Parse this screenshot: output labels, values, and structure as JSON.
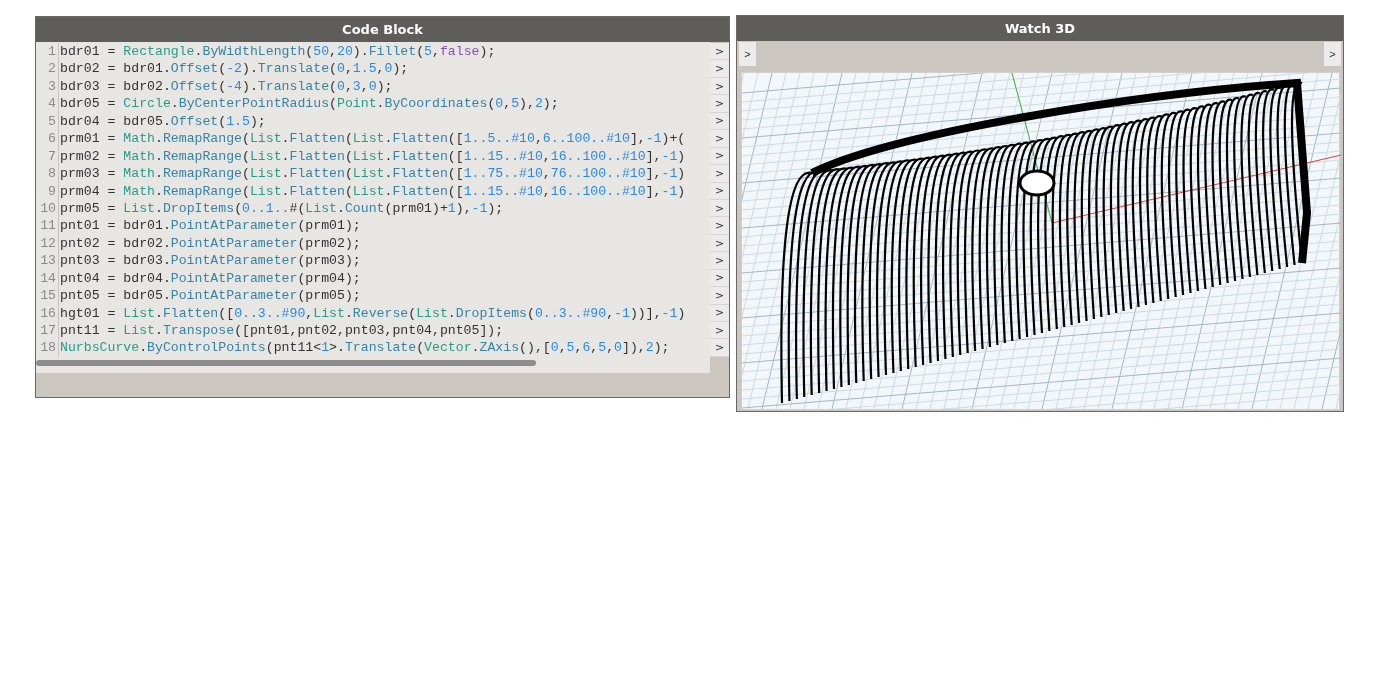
{
  "code_block": {
    "title": "Code Block",
    "lines": [
      {
        "number": "1",
        "port": ">",
        "tokens": [
          {
            "text": "bdr01 = ",
            "kind": "plain"
          },
          {
            "text": "Rectangle",
            "kind": "class"
          },
          {
            "text": ".",
            "kind": "plain"
          },
          {
            "text": "ByWidthLength",
            "kind": "method"
          },
          {
            "text": "(",
            "kind": "plain"
          },
          {
            "text": "50",
            "kind": "number"
          },
          {
            "text": ",",
            "kind": "plain"
          },
          {
            "text": "20",
            "kind": "number"
          },
          {
            "text": ").",
            "kind": "plain"
          },
          {
            "text": "Fillet",
            "kind": "method"
          },
          {
            "text": "(",
            "kind": "plain"
          },
          {
            "text": "5",
            "kind": "number"
          },
          {
            "text": ",",
            "kind": "plain"
          },
          {
            "text": "false",
            "kind": "keyword"
          },
          {
            "text": ");",
            "kind": "plain"
          }
        ]
      },
      {
        "number": "2",
        "port": ">",
        "tokens": [
          {
            "text": "bdr02 = bdr01.",
            "kind": "plain"
          },
          {
            "text": "Offset",
            "kind": "method"
          },
          {
            "text": "(",
            "kind": "plain"
          },
          {
            "text": "-2",
            "kind": "number"
          },
          {
            "text": ").",
            "kind": "plain"
          },
          {
            "text": "Translate",
            "kind": "method"
          },
          {
            "text": "(",
            "kind": "plain"
          },
          {
            "text": "0",
            "kind": "number"
          },
          {
            "text": ",",
            "kind": "plain"
          },
          {
            "text": "1.5",
            "kind": "number"
          },
          {
            "text": ",",
            "kind": "plain"
          },
          {
            "text": "0",
            "kind": "number"
          },
          {
            "text": ");",
            "kind": "plain"
          }
        ]
      },
      {
        "number": "3",
        "port": ">",
        "tokens": [
          {
            "text": "bdr03 = bdr02.",
            "kind": "plain"
          },
          {
            "text": "Offset",
            "kind": "method"
          },
          {
            "text": "(",
            "kind": "plain"
          },
          {
            "text": "-4",
            "kind": "number"
          },
          {
            "text": ").",
            "kind": "plain"
          },
          {
            "text": "Translate",
            "kind": "method"
          },
          {
            "text": "(",
            "kind": "plain"
          },
          {
            "text": "0",
            "kind": "number"
          },
          {
            "text": ",",
            "kind": "plain"
          },
          {
            "text": "3",
            "kind": "number"
          },
          {
            "text": ",",
            "kind": "plain"
          },
          {
            "text": "0",
            "kind": "number"
          },
          {
            "text": ");",
            "kind": "plain"
          }
        ]
      },
      {
        "number": "4",
        "port": ">",
        "tokens": [
          {
            "text": "bdr05 = ",
            "kind": "plain"
          },
          {
            "text": "Circle",
            "kind": "class"
          },
          {
            "text": ".",
            "kind": "plain"
          },
          {
            "text": "ByCenterPointRadius",
            "kind": "method"
          },
          {
            "text": "(",
            "kind": "plain"
          },
          {
            "text": "Point",
            "kind": "class"
          },
          {
            "text": ".",
            "kind": "plain"
          },
          {
            "text": "ByCoordinates",
            "kind": "method"
          },
          {
            "text": "(",
            "kind": "plain"
          },
          {
            "text": "0",
            "kind": "number"
          },
          {
            "text": ",",
            "kind": "plain"
          },
          {
            "text": "5",
            "kind": "number"
          },
          {
            "text": "),",
            "kind": "plain"
          },
          {
            "text": "2",
            "kind": "number"
          },
          {
            "text": ");",
            "kind": "plain"
          }
        ]
      },
      {
        "number": "5",
        "port": ">",
        "tokens": [
          {
            "text": "bdr04 = bdr05.",
            "kind": "plain"
          },
          {
            "text": "Offset",
            "kind": "method"
          },
          {
            "text": "(",
            "kind": "plain"
          },
          {
            "text": "1.5",
            "kind": "number"
          },
          {
            "text": ");",
            "kind": "plain"
          }
        ]
      },
      {
        "number": "6",
        "port": ">",
        "tokens": [
          {
            "text": "prm01 = ",
            "kind": "plain"
          },
          {
            "text": "Math",
            "kind": "class"
          },
          {
            "text": ".",
            "kind": "plain"
          },
          {
            "text": "RemapRange",
            "kind": "method"
          },
          {
            "text": "(",
            "kind": "plain"
          },
          {
            "text": "List",
            "kind": "class"
          },
          {
            "text": ".",
            "kind": "plain"
          },
          {
            "text": "Flatten",
            "kind": "method"
          },
          {
            "text": "(",
            "kind": "plain"
          },
          {
            "text": "List",
            "kind": "class"
          },
          {
            "text": ".",
            "kind": "plain"
          },
          {
            "text": "Flatten",
            "kind": "method"
          },
          {
            "text": "([",
            "kind": "plain"
          },
          {
            "text": "1..5..#10",
            "kind": "number"
          },
          {
            "text": ",",
            "kind": "plain"
          },
          {
            "text": "6..100..#10",
            "kind": "number"
          },
          {
            "text": "],",
            "kind": "plain"
          },
          {
            "text": "-1",
            "kind": "number"
          },
          {
            "text": ")+(",
            "kind": "plain"
          }
        ]
      },
      {
        "number": "7",
        "port": ">",
        "tokens": [
          {
            "text": "prm02 = ",
            "kind": "plain"
          },
          {
            "text": "Math",
            "kind": "class"
          },
          {
            "text": ".",
            "kind": "plain"
          },
          {
            "text": "RemapRange",
            "kind": "method"
          },
          {
            "text": "(",
            "kind": "plain"
          },
          {
            "text": "List",
            "kind": "class"
          },
          {
            "text": ".",
            "kind": "plain"
          },
          {
            "text": "Flatten",
            "kind": "method"
          },
          {
            "text": "(",
            "kind": "plain"
          },
          {
            "text": "List",
            "kind": "class"
          },
          {
            "text": ".",
            "kind": "plain"
          },
          {
            "text": "Flatten",
            "kind": "method"
          },
          {
            "text": "([",
            "kind": "plain"
          },
          {
            "text": "1..15..#10",
            "kind": "number"
          },
          {
            "text": ",",
            "kind": "plain"
          },
          {
            "text": "16..100..#10",
            "kind": "number"
          },
          {
            "text": "],",
            "kind": "plain"
          },
          {
            "text": "-1",
            "kind": "number"
          },
          {
            "text": ")",
            "kind": "plain"
          }
        ]
      },
      {
        "number": "8",
        "port": ">",
        "tokens": [
          {
            "text": "prm03 = ",
            "kind": "plain"
          },
          {
            "text": "Math",
            "kind": "class"
          },
          {
            "text": ".",
            "kind": "plain"
          },
          {
            "text": "RemapRange",
            "kind": "method"
          },
          {
            "text": "(",
            "kind": "plain"
          },
          {
            "text": "List",
            "kind": "class"
          },
          {
            "text": ".",
            "kind": "plain"
          },
          {
            "text": "Flatten",
            "kind": "method"
          },
          {
            "text": "(",
            "kind": "plain"
          },
          {
            "text": "List",
            "kind": "class"
          },
          {
            "text": ".",
            "kind": "plain"
          },
          {
            "text": "Flatten",
            "kind": "method"
          },
          {
            "text": "([",
            "kind": "plain"
          },
          {
            "text": "1..75..#10",
            "kind": "number"
          },
          {
            "text": ",",
            "kind": "plain"
          },
          {
            "text": "76..100..#10",
            "kind": "number"
          },
          {
            "text": "],",
            "kind": "plain"
          },
          {
            "text": "-1",
            "kind": "number"
          },
          {
            "text": ")",
            "kind": "plain"
          }
        ]
      },
      {
        "number": "9",
        "port": ">",
        "tokens": [
          {
            "text": "prm04 = ",
            "kind": "plain"
          },
          {
            "text": "Math",
            "kind": "class"
          },
          {
            "text": ".",
            "kind": "plain"
          },
          {
            "text": "RemapRange",
            "kind": "method"
          },
          {
            "text": "(",
            "kind": "plain"
          },
          {
            "text": "List",
            "kind": "class"
          },
          {
            "text": ".",
            "kind": "plain"
          },
          {
            "text": "Flatten",
            "kind": "method"
          },
          {
            "text": "(",
            "kind": "plain"
          },
          {
            "text": "List",
            "kind": "class"
          },
          {
            "text": ".",
            "kind": "plain"
          },
          {
            "text": "Flatten",
            "kind": "method"
          },
          {
            "text": "([",
            "kind": "plain"
          },
          {
            "text": "1..15..#10",
            "kind": "number"
          },
          {
            "text": ",",
            "kind": "plain"
          },
          {
            "text": "16..100..#10",
            "kind": "number"
          },
          {
            "text": "],",
            "kind": "plain"
          },
          {
            "text": "-1",
            "kind": "number"
          },
          {
            "text": ")",
            "kind": "plain"
          }
        ]
      },
      {
        "number": "10",
        "port": ">",
        "tokens": [
          {
            "text": "prm05 = ",
            "kind": "plain"
          },
          {
            "text": "List",
            "kind": "class"
          },
          {
            "text": ".",
            "kind": "plain"
          },
          {
            "text": "DropItems",
            "kind": "method"
          },
          {
            "text": "(",
            "kind": "plain"
          },
          {
            "text": "0..1..",
            "kind": "number"
          },
          {
            "text": "#(",
            "kind": "plain"
          },
          {
            "text": "List",
            "kind": "class"
          },
          {
            "text": ".",
            "kind": "plain"
          },
          {
            "text": "Count",
            "kind": "method"
          },
          {
            "text": "(prm01)+",
            "kind": "plain"
          },
          {
            "text": "1",
            "kind": "number"
          },
          {
            "text": "),",
            "kind": "plain"
          },
          {
            "text": "-1",
            "kind": "number"
          },
          {
            "text": ");",
            "kind": "plain"
          }
        ]
      },
      {
        "number": "11",
        "port": ">",
        "tokens": [
          {
            "text": "pnt01 = bdr01.",
            "kind": "plain"
          },
          {
            "text": "PointAtParameter",
            "kind": "method"
          },
          {
            "text": "(prm01);",
            "kind": "plain"
          }
        ]
      },
      {
        "number": "12",
        "port": ">",
        "tokens": [
          {
            "text": "pnt02 = bdr02.",
            "kind": "plain"
          },
          {
            "text": "PointAtParameter",
            "kind": "method"
          },
          {
            "text": "(prm02);",
            "kind": "plain"
          }
        ]
      },
      {
        "number": "13",
        "port": ">",
        "tokens": [
          {
            "text": "pnt03 = bdr03.",
            "kind": "plain"
          },
          {
            "text": "PointAtParameter",
            "kind": "method"
          },
          {
            "text": "(prm03);",
            "kind": "plain"
          }
        ]
      },
      {
        "number": "14",
        "port": ">",
        "tokens": [
          {
            "text": "pnt04 = bdr04.",
            "kind": "plain"
          },
          {
            "text": "PointAtParameter",
            "kind": "method"
          },
          {
            "text": "(prm04);",
            "kind": "plain"
          }
        ]
      },
      {
        "number": "15",
        "port": ">",
        "tokens": [
          {
            "text": "pnt05 = bdr05.",
            "kind": "plain"
          },
          {
            "text": "PointAtParameter",
            "kind": "method"
          },
          {
            "text": "(prm05);",
            "kind": "plain"
          }
        ]
      },
      {
        "number": "16",
        "port": ">",
        "tokens": [
          {
            "text": "hgt01 = ",
            "kind": "plain"
          },
          {
            "text": "List",
            "kind": "class"
          },
          {
            "text": ".",
            "kind": "plain"
          },
          {
            "text": "Flatten",
            "kind": "method"
          },
          {
            "text": "([",
            "kind": "plain"
          },
          {
            "text": "0..3..#90",
            "kind": "number"
          },
          {
            "text": ",",
            "kind": "plain"
          },
          {
            "text": "List",
            "kind": "class"
          },
          {
            "text": ".",
            "kind": "plain"
          },
          {
            "text": "Reverse",
            "kind": "method"
          },
          {
            "text": "(",
            "kind": "plain"
          },
          {
            "text": "List",
            "kind": "class"
          },
          {
            "text": ".",
            "kind": "plain"
          },
          {
            "text": "DropItems",
            "kind": "method"
          },
          {
            "text": "(",
            "kind": "plain"
          },
          {
            "text": "0..3..#90",
            "kind": "number"
          },
          {
            "text": ",",
            "kind": "plain"
          },
          {
            "text": "-1",
            "kind": "number"
          },
          {
            "text": "))],",
            "kind": "plain"
          },
          {
            "text": "-1",
            "kind": "number"
          },
          {
            "text": ")",
            "kind": "plain"
          }
        ]
      },
      {
        "number": "17",
        "port": ">",
        "tokens": [
          {
            "text": "pnt11 = ",
            "kind": "plain"
          },
          {
            "text": "List",
            "kind": "class"
          },
          {
            "text": ".",
            "kind": "plain"
          },
          {
            "text": "Transpose",
            "kind": "method"
          },
          {
            "text": "([pnt01,pnt02,pnt03,pnt04,pnt05]);",
            "kind": "plain"
          }
        ]
      },
      {
        "number": "18",
        "port": ">",
        "tokens": [
          {
            "text": "NurbsCurve",
            "kind": "class"
          },
          {
            "text": ".",
            "kind": "plain"
          },
          {
            "text": "ByControlPoints",
            "kind": "method"
          },
          {
            "text": "(pnt11<",
            "kind": "plain"
          },
          {
            "text": "1",
            "kind": "number"
          },
          {
            "text": ">.",
            "kind": "plain"
          },
          {
            "text": "Translate",
            "kind": "method"
          },
          {
            "text": "(",
            "kind": "plain"
          },
          {
            "text": "Vector",
            "kind": "class"
          },
          {
            "text": ".",
            "kind": "plain"
          },
          {
            "text": "ZAxis",
            "kind": "method"
          },
          {
            "text": "(),[",
            "kind": "plain"
          },
          {
            "text": "0",
            "kind": "number"
          },
          {
            "text": ",",
            "kind": "plain"
          },
          {
            "text": "5",
            "kind": "number"
          },
          {
            "text": ",",
            "kind": "plain"
          },
          {
            "text": "6",
            "kind": "number"
          },
          {
            "text": ",",
            "kind": "plain"
          },
          {
            "text": "5",
            "kind": "number"
          },
          {
            "text": ",",
            "kind": "plain"
          },
          {
            "text": "0",
            "kind": "number"
          },
          {
            "text": "]),",
            "kind": "plain"
          },
          {
            "text": "2",
            "kind": "number"
          },
          {
            "text": ");",
            "kind": "plain"
          }
        ]
      }
    ]
  },
  "watch_3d": {
    "title": "Watch 3D",
    "input_port": ">",
    "output_port": ">"
  }
}
